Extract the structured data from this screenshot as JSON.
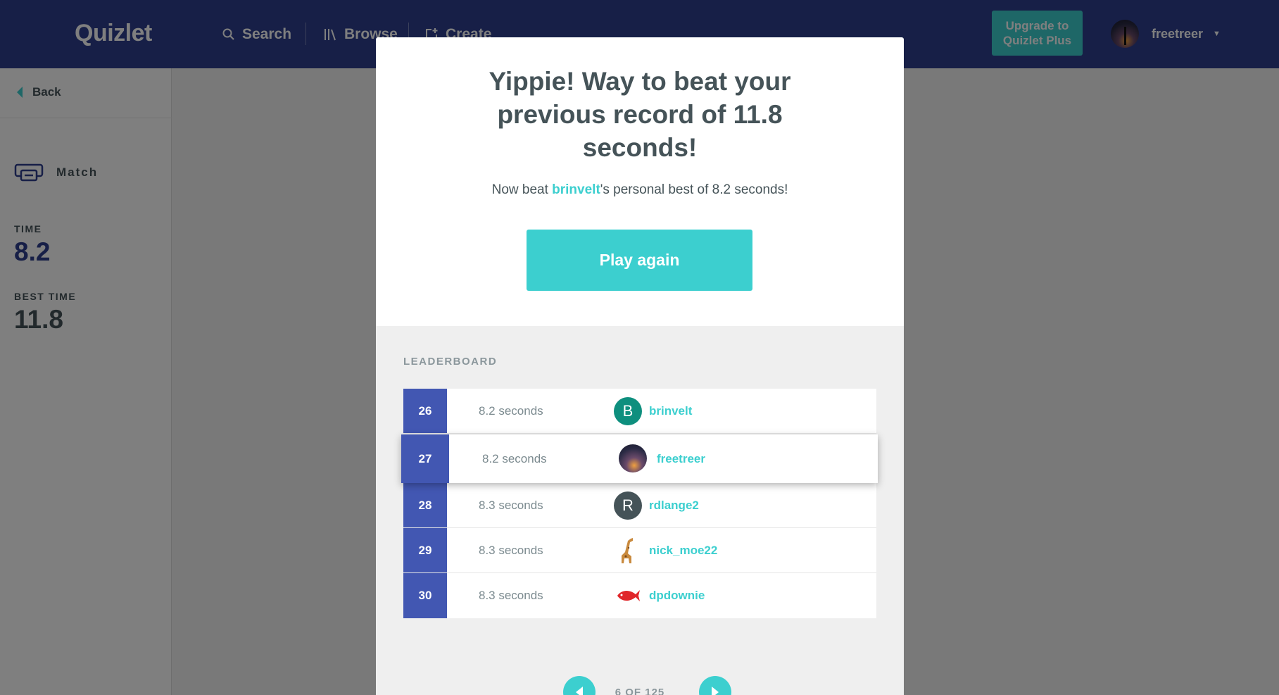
{
  "header": {
    "logo": "Quizlet",
    "nav": [
      {
        "label": "Search",
        "icon": "search-icon"
      },
      {
        "label": "Browse",
        "icon": "library-icon"
      },
      {
        "label": "Create",
        "icon": "create-icon"
      }
    ],
    "upgrade_line1": "Upgrade to",
    "upgrade_line2": "Quizlet Plus",
    "username": "freetreer",
    "caret": "▼"
  },
  "sidebar": {
    "back_label": "Back",
    "mode_label": "Match",
    "time_label": "TIME",
    "time_value": "8.2",
    "best_label": "BEST TIME",
    "best_value": "11.8"
  },
  "modal": {
    "title": "Yippie! Way to beat your previous record of 11.8 seconds!",
    "subtitle_prefix": "Now beat ",
    "subtitle_user": "brinvelt",
    "subtitle_suffix": "'s personal best of 8.2 seconds!",
    "play_again": "Play again",
    "leaderboard_title": "LEADERBOARD",
    "rows": [
      {
        "rank": "26",
        "time": "8.2 seconds",
        "avatar_letter": "B",
        "avatar_color": "#0e8f7e",
        "name": "brinvelt"
      },
      {
        "rank": "27",
        "time": "8.2 seconds",
        "avatar_letter": "",
        "avatar_color": "#2a2a44",
        "name": "freetreer"
      },
      {
        "rank": "28",
        "time": "8.3 seconds",
        "avatar_letter": "R",
        "avatar_color": "#455358",
        "name": "rdlange2"
      },
      {
        "rank": "29",
        "time": "8.3 seconds",
        "avatar_letter": "",
        "avatar_color": "#ffffff",
        "name": "nick_moe22"
      },
      {
        "rank": "30",
        "time": "8.3 seconds",
        "avatar_letter": "",
        "avatar_color": "#ffffff",
        "name": "dpdownie"
      }
    ],
    "pagination": "6 OF 125"
  },
  "colors": {
    "brand": "#2e3f8f",
    "accent": "#3ccfcf",
    "rank_bg": "#4257b2",
    "time_value": "#2e3f8f",
    "best_value": "#455358"
  }
}
